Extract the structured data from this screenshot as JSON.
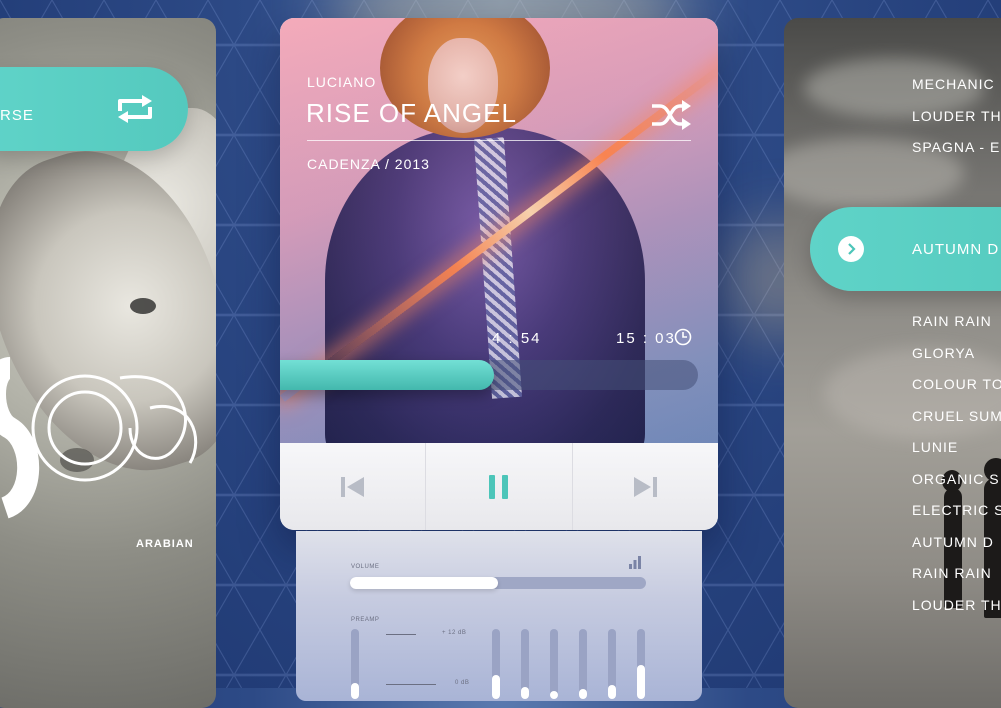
{
  "left_card": {
    "repeat_label": "RSE",
    "caption": "ARABIAN"
  },
  "player": {
    "artist": "LUCIANO",
    "title": "RISE OF ANGEL",
    "album": "CADENZA / 2013",
    "elapsed": "4 : 54",
    "total": "15 : 03",
    "progress": 0.53,
    "icons": {
      "shuffle": "shuffle-icon",
      "clock": "clock-icon",
      "previous": "skip-previous-icon",
      "pause": "pause-icon",
      "next": "skip-next-icon"
    }
  },
  "equalizer": {
    "volume_label": "VOLUME",
    "volume": 0.5,
    "preamp_label": "PREAMP",
    "plus_db": "+ 12 dB",
    "zero_db": "0 dB"
  },
  "playlist": {
    "top": [
      "MECHANIC",
      "LOUDER TH",
      "SPAGNA - E"
    ],
    "now_playing": "AUTUMN D",
    "bottom": [
      "RAIN RAIN",
      "GLORYA",
      "COLOUR TO",
      "CRUEL SUM",
      "LUNIE",
      "ORGANIC S",
      "ELECTRIC S",
      "AUTUMN D",
      "RAIN RAIN",
      "LOUDER TH"
    ]
  },
  "colors": {
    "accent": "#5fd3c8",
    "background": "#2d4a86"
  }
}
